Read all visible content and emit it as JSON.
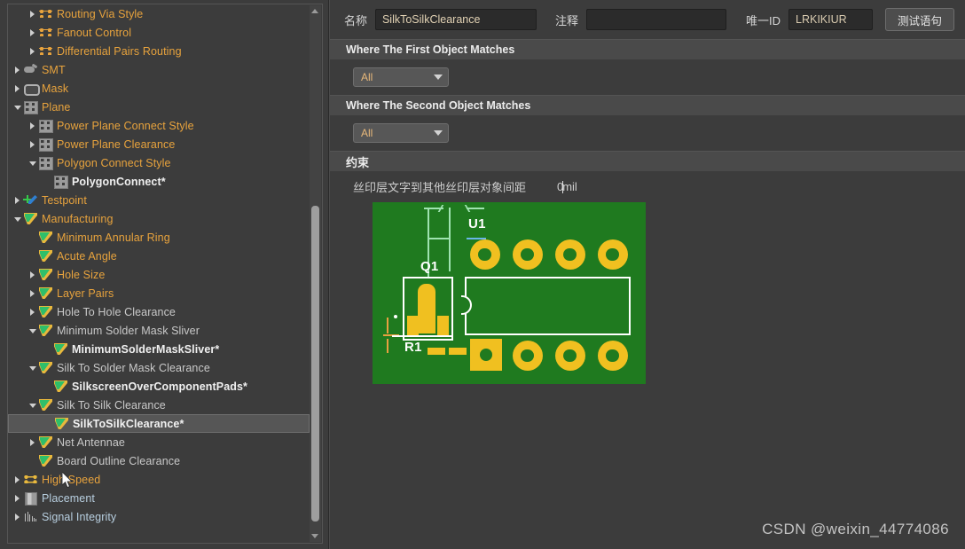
{
  "sidebar": {
    "scrollbar": {
      "up_icon": "scroll-up-arrow",
      "down_icon": "scroll-down-arrow"
    },
    "items": [
      {
        "label": "Routing Via Style",
        "indent": 3,
        "twisty": "right",
        "icon": "routing-icon",
        "color": "orange",
        "bold": false,
        "selected": false
      },
      {
        "label": "Fanout Control",
        "indent": 3,
        "twisty": "right",
        "icon": "routing-icon",
        "color": "orange",
        "bold": false,
        "selected": false
      },
      {
        "label": "Differential Pairs Routing",
        "indent": 3,
        "twisty": "right",
        "icon": "routing-icon",
        "color": "orange",
        "bold": false,
        "selected": false
      },
      {
        "label": "SMT",
        "indent": 2,
        "twisty": "right",
        "icon": "smt-icon",
        "color": "orange",
        "bold": false,
        "selected": false
      },
      {
        "label": "Mask",
        "indent": 2,
        "twisty": "right",
        "icon": "mask-icon",
        "color": "orange",
        "bold": false,
        "selected": false
      },
      {
        "label": "Plane",
        "indent": 2,
        "twisty": "down",
        "icon": "plane-icon",
        "color": "orange",
        "bold": false,
        "selected": false
      },
      {
        "label": "Power Plane Connect Style",
        "indent": 3,
        "twisty": "right",
        "icon": "plane-icon",
        "color": "orange",
        "bold": false,
        "selected": false
      },
      {
        "label": "Power Plane Clearance",
        "indent": 3,
        "twisty": "right",
        "icon": "plane-icon",
        "color": "orange",
        "bold": false,
        "selected": false
      },
      {
        "label": "Polygon Connect Style",
        "indent": 3,
        "twisty": "down",
        "icon": "plane-icon",
        "color": "orange",
        "bold": false,
        "selected": false
      },
      {
        "label": "PolygonConnect*",
        "indent": 4,
        "twisty": "none",
        "icon": "plane-icon",
        "color": "white",
        "bold": true,
        "selected": false
      },
      {
        "label": "Testpoint",
        "indent": 2,
        "twisty": "right",
        "icon": "testpoint-icon",
        "color": "orange",
        "bold": false,
        "selected": false
      },
      {
        "label": "Manufacturing",
        "indent": 2,
        "twisty": "down",
        "icon": "flag-icon",
        "color": "orange",
        "bold": false,
        "selected": false
      },
      {
        "label": "Minimum Annular Ring",
        "indent": 3,
        "twisty": "none",
        "icon": "flag-icon",
        "color": "orange",
        "bold": false,
        "selected": false
      },
      {
        "label": "Acute Angle",
        "indent": 3,
        "twisty": "none",
        "icon": "flag-icon",
        "color": "orange",
        "bold": false,
        "selected": false
      },
      {
        "label": "Hole Size",
        "indent": 3,
        "twisty": "right",
        "icon": "flag-icon",
        "color": "orange",
        "bold": false,
        "selected": false
      },
      {
        "label": "Layer Pairs",
        "indent": 3,
        "twisty": "right",
        "icon": "flag-icon",
        "color": "orange",
        "bold": false,
        "selected": false
      },
      {
        "label": "Hole To Hole Clearance",
        "indent": 3,
        "twisty": "right",
        "icon": "flag-icon",
        "color": "gray",
        "bold": false,
        "selected": false
      },
      {
        "label": "Minimum Solder Mask Sliver",
        "indent": 3,
        "twisty": "down",
        "icon": "flag-icon",
        "color": "gray",
        "bold": false,
        "selected": false
      },
      {
        "label": "MinimumSolderMaskSliver*",
        "indent": 4,
        "twisty": "none",
        "icon": "flag-icon",
        "color": "white",
        "bold": true,
        "selected": false
      },
      {
        "label": "Silk To Solder Mask Clearance",
        "indent": 3,
        "twisty": "down",
        "icon": "flag-icon",
        "color": "gray",
        "bold": false,
        "selected": false
      },
      {
        "label": "SilkscreenOverComponentPads*",
        "indent": 4,
        "twisty": "none",
        "icon": "flag-icon",
        "color": "white",
        "bold": true,
        "selected": false
      },
      {
        "label": "Silk To Silk Clearance",
        "indent": 3,
        "twisty": "down",
        "icon": "flag-icon",
        "color": "gray",
        "bold": false,
        "selected": false
      },
      {
        "label": "SilkToSilkClearance*",
        "indent": 4,
        "twisty": "none",
        "icon": "flag-icon",
        "color": "white",
        "bold": true,
        "selected": true
      },
      {
        "label": "Net Antennae",
        "indent": 3,
        "twisty": "right",
        "icon": "flag-icon",
        "color": "gray",
        "bold": false,
        "selected": false
      },
      {
        "label": "Board Outline Clearance",
        "indent": 3,
        "twisty": "none",
        "icon": "flag-icon",
        "color": "gray",
        "bold": false,
        "selected": false
      },
      {
        "label": "High Speed",
        "indent": 2,
        "twisty": "right",
        "icon": "high-speed-icon",
        "color": "orange",
        "bold": false,
        "selected": false
      },
      {
        "label": "Placement",
        "indent": 2,
        "twisty": "right",
        "icon": "placement-icon",
        "color": "blue",
        "bold": false,
        "selected": false
      },
      {
        "label": "Signal Integrity",
        "indent": 2,
        "twisty": "right",
        "icon": "signal-integrity-icon",
        "color": "blue",
        "bold": false,
        "selected": false
      }
    ]
  },
  "detail": {
    "name_label": "名称",
    "name_value": "SilkToSilkClearance",
    "comment_label": "注释",
    "comment_value": "",
    "comment_placeholder": "",
    "uid_label": "唯一ID",
    "uid_value": "LRKIKIUR",
    "test_button": "测试语句",
    "first_object_header": "Where The First Object Matches",
    "first_object_scope": "All",
    "second_object_header": "Where The Second Object Matches",
    "second_object_scope": "All",
    "constraint_header": "约束",
    "constraint_label": "丝印层文字到其他丝印层对象间距",
    "constraint_value": "0mil"
  },
  "pcb": {
    "designators": {
      "u1": "U1",
      "q1": "Q1",
      "r1": "R1"
    },
    "colors": {
      "board": "#1f7a1f",
      "pad": "#f0c020",
      "silkscreen": "#ffffff",
      "dimension": "#9fe3b0",
      "dimension_alt": "#e8a040"
    },
    "top_pads": 4,
    "bottom_pads": 4
  },
  "watermark": "CSDN @weixin_44774086"
}
